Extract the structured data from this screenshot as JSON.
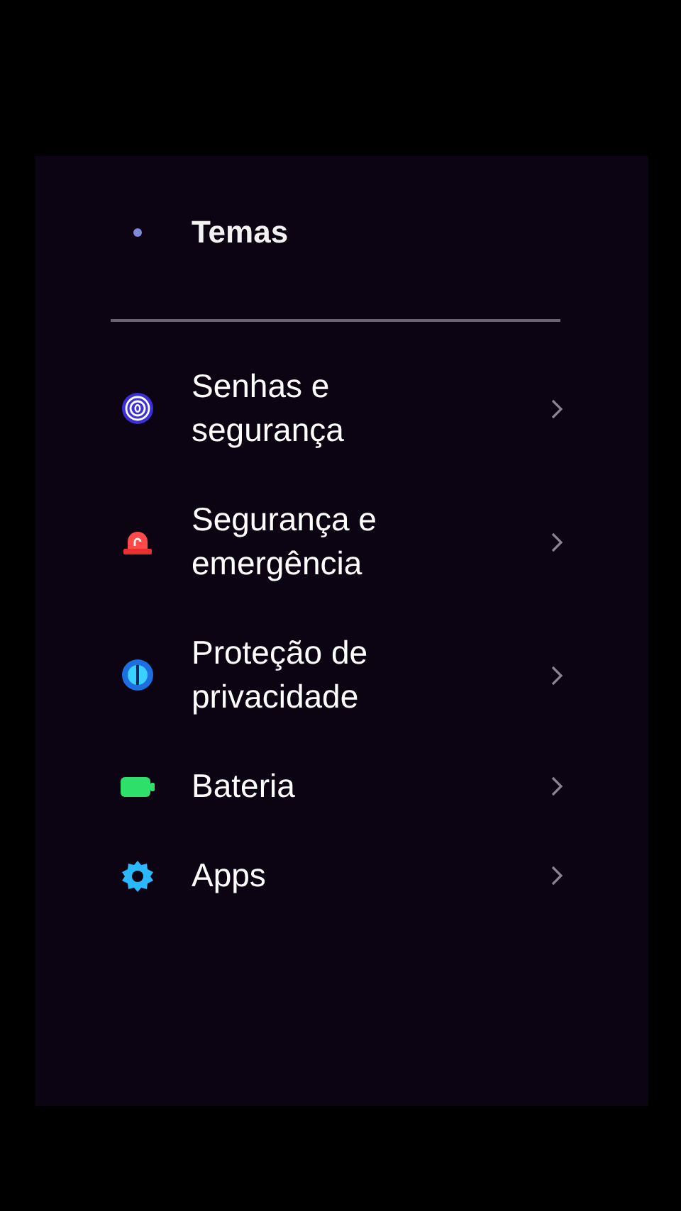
{
  "top_item": {
    "label": "Temas"
  },
  "items": [
    {
      "kind": "fingerprint",
      "label": "Senhas e segurança"
    },
    {
      "kind": "alarm",
      "label": "Segurança e emergência"
    },
    {
      "kind": "shield",
      "label": "Proteção de privacidade"
    },
    {
      "kind": "battery",
      "label": "Bateria"
    },
    {
      "kind": "gear",
      "label": "Apps"
    }
  ]
}
